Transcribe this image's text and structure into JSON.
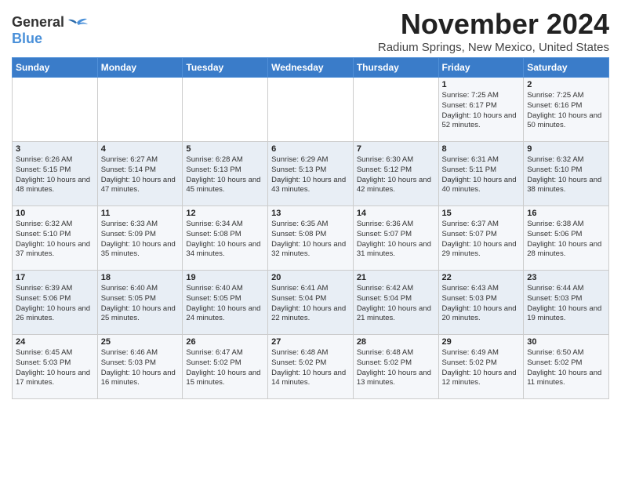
{
  "logo": {
    "general": "General",
    "blue": "Blue"
  },
  "title": "November 2024",
  "subtitle": "Radium Springs, New Mexico, United States",
  "days_of_week": [
    "Sunday",
    "Monday",
    "Tuesday",
    "Wednesday",
    "Thursday",
    "Friday",
    "Saturday"
  ],
  "weeks": [
    [
      {
        "day": "",
        "sunrise": "",
        "sunset": "",
        "daylight": ""
      },
      {
        "day": "",
        "sunrise": "",
        "sunset": "",
        "daylight": ""
      },
      {
        "day": "",
        "sunrise": "",
        "sunset": "",
        "daylight": ""
      },
      {
        "day": "",
        "sunrise": "",
        "sunset": "",
        "daylight": ""
      },
      {
        "day": "",
        "sunrise": "",
        "sunset": "",
        "daylight": ""
      },
      {
        "day": "1",
        "sunrise": "Sunrise: 7:25 AM",
        "sunset": "Sunset: 6:17 PM",
        "daylight": "Daylight: 10 hours and 52 minutes."
      },
      {
        "day": "2",
        "sunrise": "Sunrise: 7:25 AM",
        "sunset": "Sunset: 6:16 PM",
        "daylight": "Daylight: 10 hours and 50 minutes."
      }
    ],
    [
      {
        "day": "3",
        "sunrise": "Sunrise: 6:26 AM",
        "sunset": "Sunset: 5:15 PM",
        "daylight": "Daylight: 10 hours and 48 minutes."
      },
      {
        "day": "4",
        "sunrise": "Sunrise: 6:27 AM",
        "sunset": "Sunset: 5:14 PM",
        "daylight": "Daylight: 10 hours and 47 minutes."
      },
      {
        "day": "5",
        "sunrise": "Sunrise: 6:28 AM",
        "sunset": "Sunset: 5:13 PM",
        "daylight": "Daylight: 10 hours and 45 minutes."
      },
      {
        "day": "6",
        "sunrise": "Sunrise: 6:29 AM",
        "sunset": "Sunset: 5:13 PM",
        "daylight": "Daylight: 10 hours and 43 minutes."
      },
      {
        "day": "7",
        "sunrise": "Sunrise: 6:30 AM",
        "sunset": "Sunset: 5:12 PM",
        "daylight": "Daylight: 10 hours and 42 minutes."
      },
      {
        "day": "8",
        "sunrise": "Sunrise: 6:31 AM",
        "sunset": "Sunset: 5:11 PM",
        "daylight": "Daylight: 10 hours and 40 minutes."
      },
      {
        "day": "9",
        "sunrise": "Sunrise: 6:32 AM",
        "sunset": "Sunset: 5:10 PM",
        "daylight": "Daylight: 10 hours and 38 minutes."
      }
    ],
    [
      {
        "day": "10",
        "sunrise": "Sunrise: 6:32 AM",
        "sunset": "Sunset: 5:10 PM",
        "daylight": "Daylight: 10 hours and 37 minutes."
      },
      {
        "day": "11",
        "sunrise": "Sunrise: 6:33 AM",
        "sunset": "Sunset: 5:09 PM",
        "daylight": "Daylight: 10 hours and 35 minutes."
      },
      {
        "day": "12",
        "sunrise": "Sunrise: 6:34 AM",
        "sunset": "Sunset: 5:08 PM",
        "daylight": "Daylight: 10 hours and 34 minutes."
      },
      {
        "day": "13",
        "sunrise": "Sunrise: 6:35 AM",
        "sunset": "Sunset: 5:08 PM",
        "daylight": "Daylight: 10 hours and 32 minutes."
      },
      {
        "day": "14",
        "sunrise": "Sunrise: 6:36 AM",
        "sunset": "Sunset: 5:07 PM",
        "daylight": "Daylight: 10 hours and 31 minutes."
      },
      {
        "day": "15",
        "sunrise": "Sunrise: 6:37 AM",
        "sunset": "Sunset: 5:07 PM",
        "daylight": "Daylight: 10 hours and 29 minutes."
      },
      {
        "day": "16",
        "sunrise": "Sunrise: 6:38 AM",
        "sunset": "Sunset: 5:06 PM",
        "daylight": "Daylight: 10 hours and 28 minutes."
      }
    ],
    [
      {
        "day": "17",
        "sunrise": "Sunrise: 6:39 AM",
        "sunset": "Sunset: 5:06 PM",
        "daylight": "Daylight: 10 hours and 26 minutes."
      },
      {
        "day": "18",
        "sunrise": "Sunrise: 6:40 AM",
        "sunset": "Sunset: 5:05 PM",
        "daylight": "Daylight: 10 hours and 25 minutes."
      },
      {
        "day": "19",
        "sunrise": "Sunrise: 6:40 AM",
        "sunset": "Sunset: 5:05 PM",
        "daylight": "Daylight: 10 hours and 24 minutes."
      },
      {
        "day": "20",
        "sunrise": "Sunrise: 6:41 AM",
        "sunset": "Sunset: 5:04 PM",
        "daylight": "Daylight: 10 hours and 22 minutes."
      },
      {
        "day": "21",
        "sunrise": "Sunrise: 6:42 AM",
        "sunset": "Sunset: 5:04 PM",
        "daylight": "Daylight: 10 hours and 21 minutes."
      },
      {
        "day": "22",
        "sunrise": "Sunrise: 6:43 AM",
        "sunset": "Sunset: 5:03 PM",
        "daylight": "Daylight: 10 hours and 20 minutes."
      },
      {
        "day": "23",
        "sunrise": "Sunrise: 6:44 AM",
        "sunset": "Sunset: 5:03 PM",
        "daylight": "Daylight: 10 hours and 19 minutes."
      }
    ],
    [
      {
        "day": "24",
        "sunrise": "Sunrise: 6:45 AM",
        "sunset": "Sunset: 5:03 PM",
        "daylight": "Daylight: 10 hours and 17 minutes."
      },
      {
        "day": "25",
        "sunrise": "Sunrise: 6:46 AM",
        "sunset": "Sunset: 5:03 PM",
        "daylight": "Daylight: 10 hours and 16 minutes."
      },
      {
        "day": "26",
        "sunrise": "Sunrise: 6:47 AM",
        "sunset": "Sunset: 5:02 PM",
        "daylight": "Daylight: 10 hours and 15 minutes."
      },
      {
        "day": "27",
        "sunrise": "Sunrise: 6:48 AM",
        "sunset": "Sunset: 5:02 PM",
        "daylight": "Daylight: 10 hours and 14 minutes."
      },
      {
        "day": "28",
        "sunrise": "Sunrise: 6:48 AM",
        "sunset": "Sunset: 5:02 PM",
        "daylight": "Daylight: 10 hours and 13 minutes."
      },
      {
        "day": "29",
        "sunrise": "Sunrise: 6:49 AM",
        "sunset": "Sunset: 5:02 PM",
        "daylight": "Daylight: 10 hours and 12 minutes."
      },
      {
        "day": "30",
        "sunrise": "Sunrise: 6:50 AM",
        "sunset": "Sunset: 5:02 PM",
        "daylight": "Daylight: 10 hours and 11 minutes."
      }
    ]
  ]
}
